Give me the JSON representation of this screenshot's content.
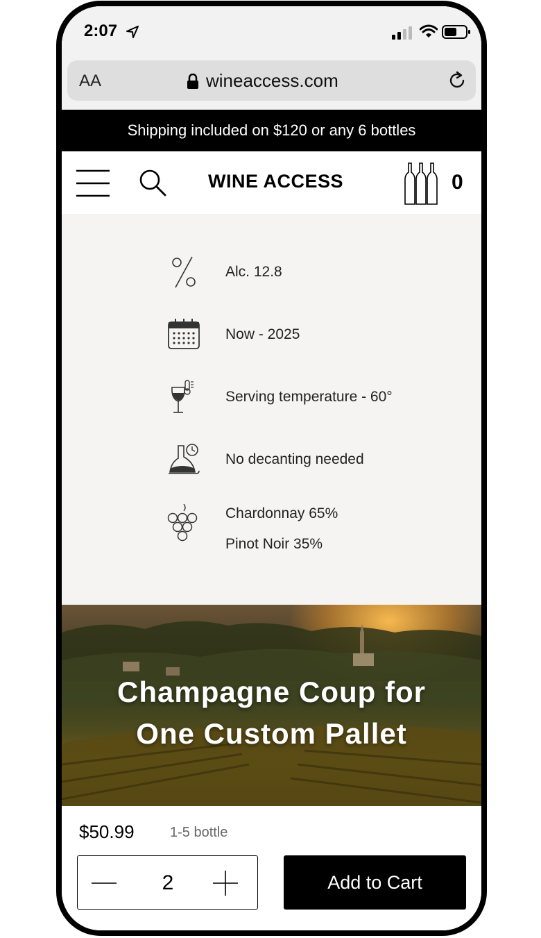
{
  "status_bar": {
    "time": "2:07"
  },
  "browser": {
    "text_size_label": "AA",
    "url": "wineaccess.com"
  },
  "banner": {
    "text": "Shipping included on $120 or any 6 bottles"
  },
  "header": {
    "brand": "WINE ACCESS",
    "cart_count": "0"
  },
  "details": [
    {
      "icon": "percent-icon",
      "text": "Alc. 12.8"
    },
    {
      "icon": "calendar-icon",
      "text": "Now - 2025"
    },
    {
      "icon": "wine-glass-thermometer-icon",
      "text": "Serving temperature - 60°"
    },
    {
      "icon": "decanter-icon",
      "text": "No decanting needed"
    },
    {
      "icon": "grapes-icon",
      "text": "Chardonnay 65%",
      "text2": "Pinot Noir 35%"
    }
  ],
  "hero": {
    "title_line1": "Champagne Coup for",
    "title_line2": "One Custom Pallet"
  },
  "purchase": {
    "price": "$50.99",
    "price_note": "1-5 bottle",
    "quantity": "2",
    "add_to_cart": "Add to Cart"
  },
  "colors": {
    "banner_bg": "#000000",
    "button_bg": "#000000",
    "details_bg": "#f5f4f2"
  }
}
